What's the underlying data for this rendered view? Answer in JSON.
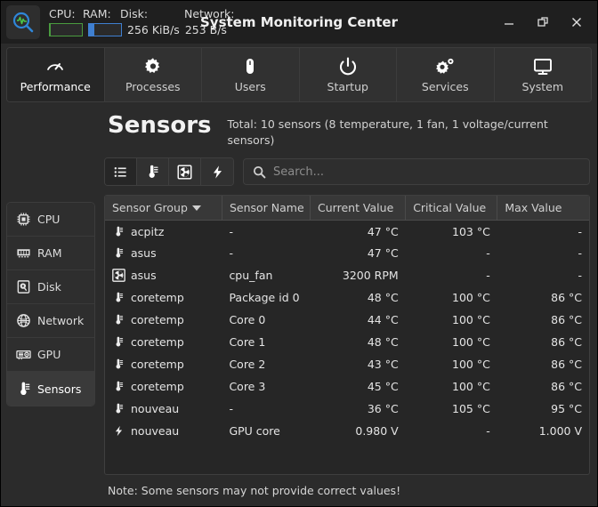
{
  "window": {
    "title": "System Monitoring Center",
    "logo_icon": "magnifier-waveform-icon",
    "controls": [
      {
        "name": "minimize-button",
        "icon": "minimize-icon"
      },
      {
        "name": "restore-button",
        "icon": "restore-icon"
      },
      {
        "name": "close-button",
        "icon": "close-icon"
      }
    ]
  },
  "monitor": {
    "cpu_label": "CPU:",
    "ram_label": "RAM:",
    "disk_label": "Disk:",
    "network_label": "Network:",
    "disk_rate": "256 KiB/s",
    "network_rate": "253 B/s",
    "cpu_color": "#4a9b3f",
    "ram_color": "#3f7fd0"
  },
  "tabs": [
    {
      "label": "Performance",
      "icon": "gauge-icon",
      "active": true
    },
    {
      "label": "Processes",
      "icon": "gear-icon",
      "active": false
    },
    {
      "label": "Users",
      "icon": "mouse-icon",
      "active": false
    },
    {
      "label": "Startup",
      "icon": "power-icon",
      "active": false
    },
    {
      "label": "Services",
      "icon": "gears-icon",
      "active": false
    },
    {
      "label": "System",
      "icon": "monitor-icon",
      "active": false
    }
  ],
  "sidebar": {
    "items": [
      {
        "label": "CPU",
        "icon": "cpu-chip-icon",
        "active": false
      },
      {
        "label": "RAM",
        "icon": "memory-stick-icon",
        "active": false
      },
      {
        "label": "Disk",
        "icon": "hard-disk-icon",
        "active": false
      },
      {
        "label": "Network",
        "icon": "globe-icon",
        "active": false
      },
      {
        "label": "GPU",
        "icon": "graphics-card-icon",
        "active": false
      },
      {
        "label": "Sensors",
        "icon": "thermometer-icon",
        "active": true
      }
    ]
  },
  "page": {
    "title": "Sensors",
    "subtitle": "Total: 10 sensors (8 temperature, 1 fan, 1 voltage/current sensors)",
    "note": "Note: Some sensors may not provide correct values!"
  },
  "toolbar": {
    "filters": [
      {
        "name": "filter-all",
        "icon": "list-icon",
        "active": true
      },
      {
        "name": "filter-temperature",
        "icon": "thermometer-icon",
        "active": false
      },
      {
        "name": "filter-fan",
        "icon": "fan-icon",
        "active": false
      },
      {
        "name": "filter-voltage",
        "icon": "lightning-icon",
        "active": false
      }
    ],
    "search_placeholder": "Search...",
    "search_value": "",
    "search_icon": "search-icon"
  },
  "table": {
    "columns": [
      {
        "label": "Sensor Group",
        "sorted": true,
        "sort_dir": "desc",
        "align": "left"
      },
      {
        "label": "Sensor Name",
        "sorted": false,
        "align": "left"
      },
      {
        "label": "Current Value",
        "sorted": false,
        "align": "right"
      },
      {
        "label": "Critical Value",
        "sorted": false,
        "align": "right"
      },
      {
        "label": "Max Value",
        "sorted": false,
        "align": "right"
      }
    ],
    "rows": [
      {
        "icon": "thermometer-icon",
        "group": "acpitz",
        "name": "-",
        "current": "47 °C",
        "critical": "103 °C",
        "max": "-"
      },
      {
        "icon": "thermometer-icon",
        "group": "asus",
        "name": "-",
        "current": "47 °C",
        "critical": "-",
        "max": "-"
      },
      {
        "icon": "fan-icon",
        "group": "asus",
        "name": "cpu_fan",
        "current": "3200 RPM",
        "critical": "-",
        "max": "-"
      },
      {
        "icon": "thermometer-icon",
        "group": "coretemp",
        "name": "Package id 0",
        "current": "48 °C",
        "critical": "100 °C",
        "max": "86 °C"
      },
      {
        "icon": "thermometer-icon",
        "group": "coretemp",
        "name": "Core 0",
        "current": "44 °C",
        "critical": "100 °C",
        "max": "86 °C"
      },
      {
        "icon": "thermometer-icon",
        "group": "coretemp",
        "name": "Core 1",
        "current": "48 °C",
        "critical": "100 °C",
        "max": "86 °C"
      },
      {
        "icon": "thermometer-icon",
        "group": "coretemp",
        "name": "Core 2",
        "current": "43 °C",
        "critical": "100 °C",
        "max": "86 °C"
      },
      {
        "icon": "thermometer-icon",
        "group": "coretemp",
        "name": "Core 3",
        "current": "45 °C",
        "critical": "100 °C",
        "max": "86 °C"
      },
      {
        "icon": "thermometer-icon",
        "group": "nouveau",
        "name": "-",
        "current": "36 °C",
        "critical": "105 °C",
        "max": "95 °C"
      },
      {
        "icon": "lightning-icon",
        "group": "nouveau",
        "name": "GPU core",
        "current": "0.980 V",
        "critical": "-",
        "max": "1.000 V"
      }
    ]
  }
}
